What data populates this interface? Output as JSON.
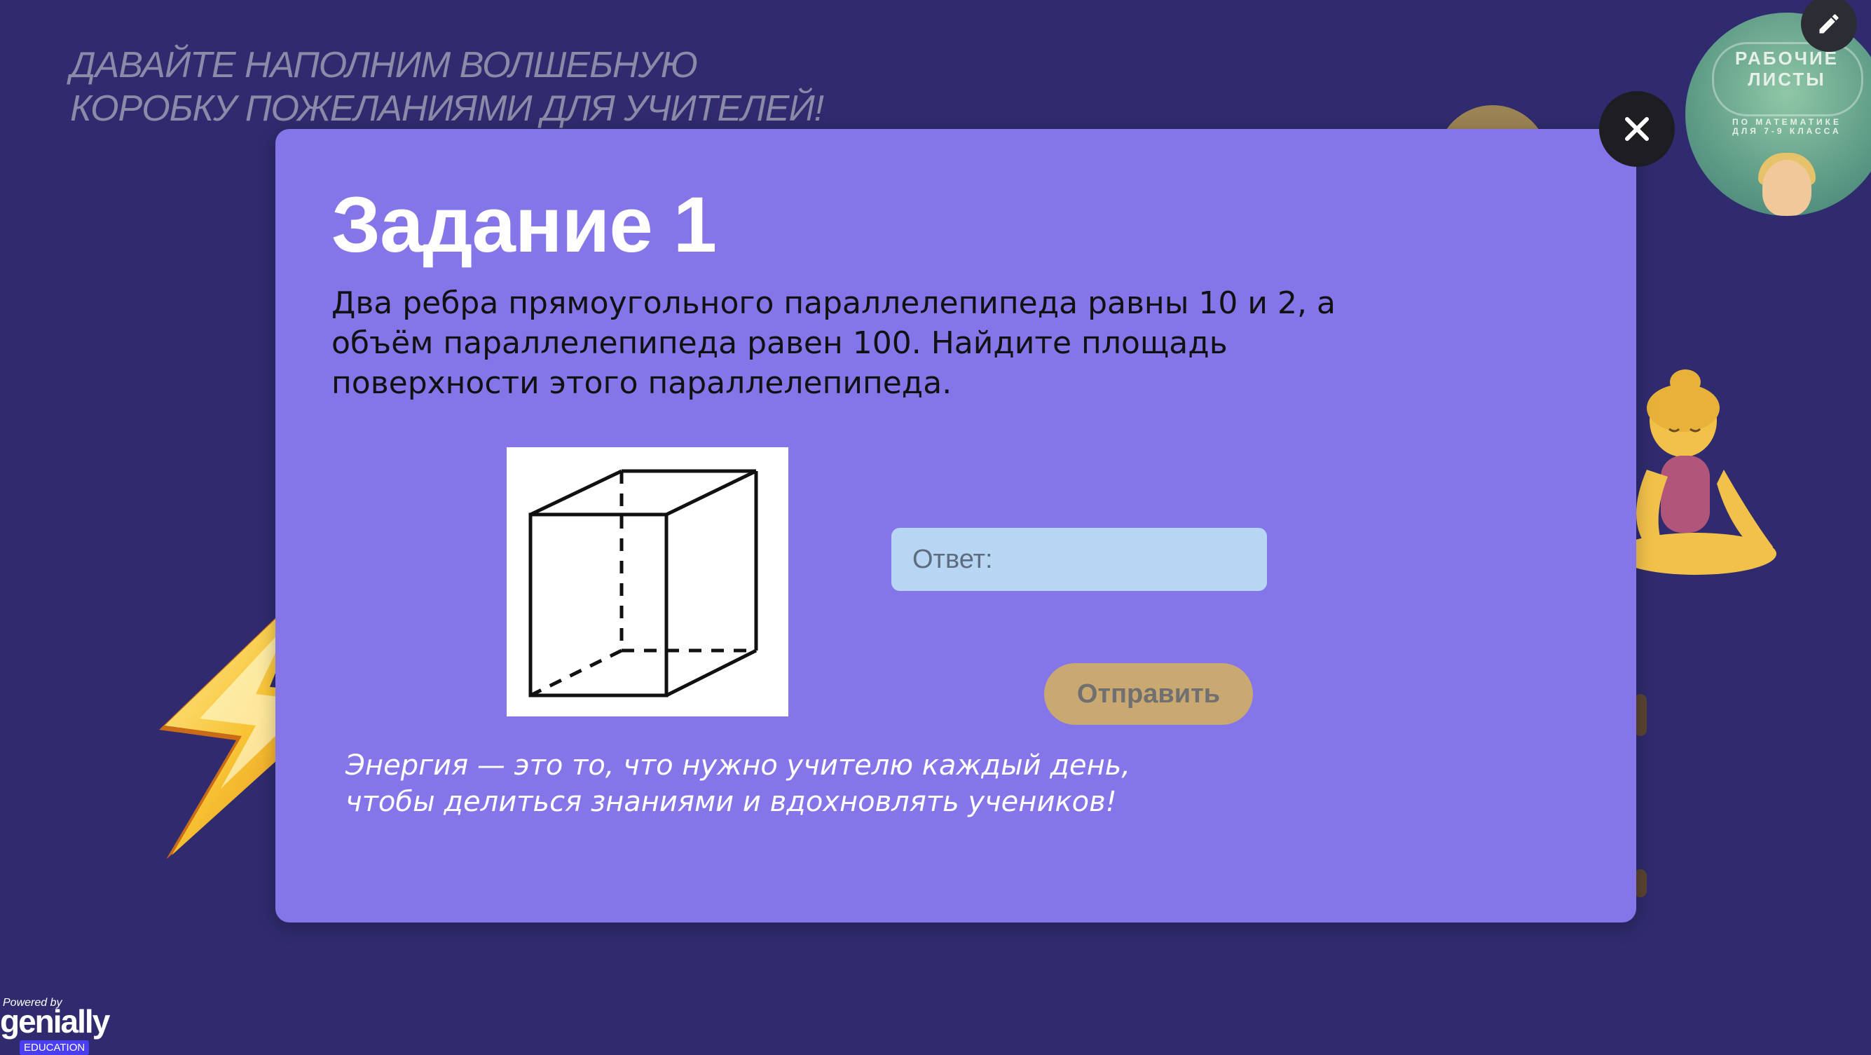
{
  "background": {
    "heading": "ДАВАЙТЕ НАПОЛНИМ ВОЛШЕБНУЮ\nКОРОБКУ ПОЖЕЛАНИЯМИ ДЛЯ УЧИТЕЛЕЙ!",
    "badge": {
      "title": "РАБОЧИЕ\nЛИСТЫ",
      "subtitle": "ПО МАТЕМАТИКЕ\nДЛЯ 7-9 КЛАССА"
    },
    "branding": {
      "powered_by": "Powered by",
      "name": "genially",
      "tag": "EDUCATION"
    }
  },
  "modal": {
    "title": "Задание 1",
    "task_text": "Два ребра прямоугольного параллелепипеда равны 10 и 2, а объём параллелепипеда равен 100. Найдите площадь поверхности этого параллелепипеда.",
    "quote": "Энергия — это то, что нужно учителю каждый день,\nчтобы делиться знаниями и вдохновлять учеников!",
    "answer_placeholder": "Ответ:",
    "answer_value": "",
    "submit_label": "Отправить"
  },
  "icons": {
    "close": "close-icon",
    "edit": "pencil-icon",
    "lightning": "lightning-icon",
    "figure": "parallelepiped-figure",
    "yogi": "woman-in-lotus-position-icon"
  },
  "colors": {
    "page_bg": "#2f2b6e",
    "modal_bg": "#8476e8",
    "answer_bg": "#b7d6f4",
    "submit_bg": "#c9a872",
    "close_bg": "#1e1e22"
  }
}
